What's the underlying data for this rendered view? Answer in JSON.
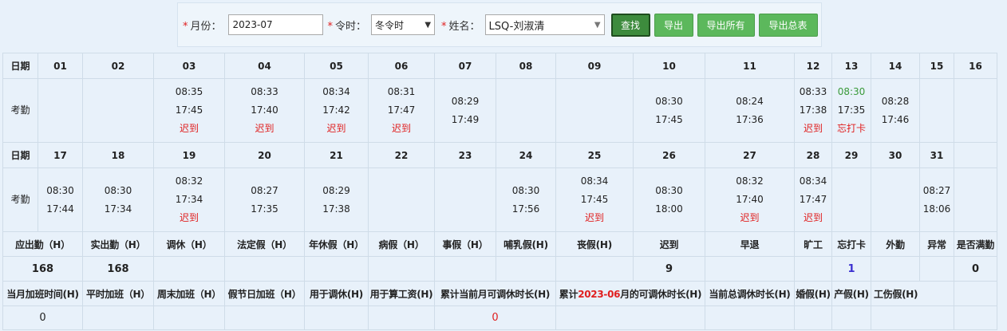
{
  "filters": {
    "month_label": "月份：",
    "month_value": "2023-07",
    "season_label": "令时：",
    "season_value": "冬令时",
    "name_label": "姓名：",
    "name_value": "LSQ-刘淑清",
    "required_mark": "*"
  },
  "buttons": {
    "search": "查找",
    "export": "导出",
    "export_all": "导出所有",
    "export_summary": "导出总表"
  },
  "labels": {
    "date": "日期",
    "attendance": "考勤"
  },
  "week1": {
    "days": [
      "01",
      "02",
      "03",
      "04",
      "05",
      "06",
      "07",
      "08",
      "09",
      "10",
      "11",
      "12",
      "13",
      "14",
      "15",
      "16"
    ],
    "cells": [
      {
        "in": "",
        "out": "",
        "note": ""
      },
      {
        "in": "",
        "out": "",
        "note": ""
      },
      {
        "in": "08:35",
        "out": "17:45",
        "note": "迟到"
      },
      {
        "in": "08:33",
        "out": "17:40",
        "note": "迟到"
      },
      {
        "in": "08:34",
        "out": "17:42",
        "note": "迟到"
      },
      {
        "in": "08:31",
        "out": "17:47",
        "note": "迟到"
      },
      {
        "in": "08:29",
        "out": "17:49",
        "note": ""
      },
      {
        "in": "",
        "out": "",
        "note": ""
      },
      {
        "in": "",
        "out": "",
        "note": ""
      },
      {
        "in": "08:30",
        "out": "17:45",
        "note": ""
      },
      {
        "in": "08:24",
        "out": "17:36",
        "note": ""
      },
      {
        "in": "08:33",
        "out": "17:38",
        "note": "迟到"
      },
      {
        "in": "08:30",
        "out": "17:35",
        "note": "忘打卡"
      },
      {
        "in": "08:28",
        "out": "17:46",
        "note": ""
      },
      {
        "in": "",
        "out": "",
        "note": ""
      },
      {
        "in": "",
        "out": "",
        "note": ""
      }
    ]
  },
  "week2": {
    "days": [
      "17",
      "18",
      "19",
      "20",
      "21",
      "22",
      "23",
      "24",
      "25",
      "26",
      "27",
      "28",
      "29",
      "30",
      "31",
      ""
    ],
    "cells": [
      {
        "in": "08:30",
        "out": "17:44",
        "note": ""
      },
      {
        "in": "08:30",
        "out": "17:34",
        "note": ""
      },
      {
        "in": "08:32",
        "out": "17:34",
        "note": "迟到"
      },
      {
        "in": "08:27",
        "out": "17:35",
        "note": ""
      },
      {
        "in": "08:29",
        "out": "17:38",
        "note": ""
      },
      {
        "in": "",
        "out": "",
        "note": ""
      },
      {
        "in": "",
        "out": "",
        "note": ""
      },
      {
        "in": "08:30",
        "out": "17:56",
        "note": ""
      },
      {
        "in": "08:34",
        "out": "17:45",
        "note": "迟到"
      },
      {
        "in": "08:30",
        "out": "18:00",
        "note": ""
      },
      {
        "in": "08:32",
        "out": "17:40",
        "note": "迟到"
      },
      {
        "in": "08:34",
        "out": "17:47",
        "note": "迟到"
      },
      {
        "in": "",
        "out": "",
        "note": ""
      },
      {
        "in": "",
        "out": "",
        "note": ""
      },
      {
        "in": "08:27",
        "out": "18:06",
        "note": ""
      },
      {
        "in": "",
        "out": "",
        "note": ""
      }
    ]
  },
  "summary_headers": [
    "应出勤（H）",
    "实出勤（H）",
    "调休（H）",
    "法定假（H）",
    "年休假（H）",
    "病假（H）",
    "事假（H）",
    "哺乳假(H)",
    "丧假(H)",
    "迟到",
    "早退",
    "旷工",
    "忘打卡",
    "外勤",
    "异常",
    "是否满勤"
  ],
  "summary_values": [
    "168",
    "168",
    "",
    "",
    "",
    "",
    "",
    "",
    "",
    "9",
    "",
    "",
    "1",
    "",
    "",
    "0"
  ],
  "overtime_headers": {
    "h1": "当月加班时间(H)",
    "h2": "平时加班（H）",
    "h3": "周末加班（H）",
    "h4": "假节日加班（H）",
    "h5": "用于调休(H)",
    "h6": "用于算工资(H)",
    "h7": "累计当前月可调休时长(H)",
    "h8_pre": "累计",
    "h8_month": "2023-06",
    "h8_post": "月的可调休时长(H)",
    "h9": "当前总调休时长(H)",
    "h10": "婚假(H)",
    "h11": "产假(H)",
    "h12": "工伤假(H)"
  },
  "overtime_values": {
    "v1": "0",
    "v7": "0"
  },
  "colors": {
    "late": "#e02020",
    "button_green": "#5cb85c",
    "green_time": "#3a9a3a",
    "purple_count": "#3a2fd0"
  }
}
